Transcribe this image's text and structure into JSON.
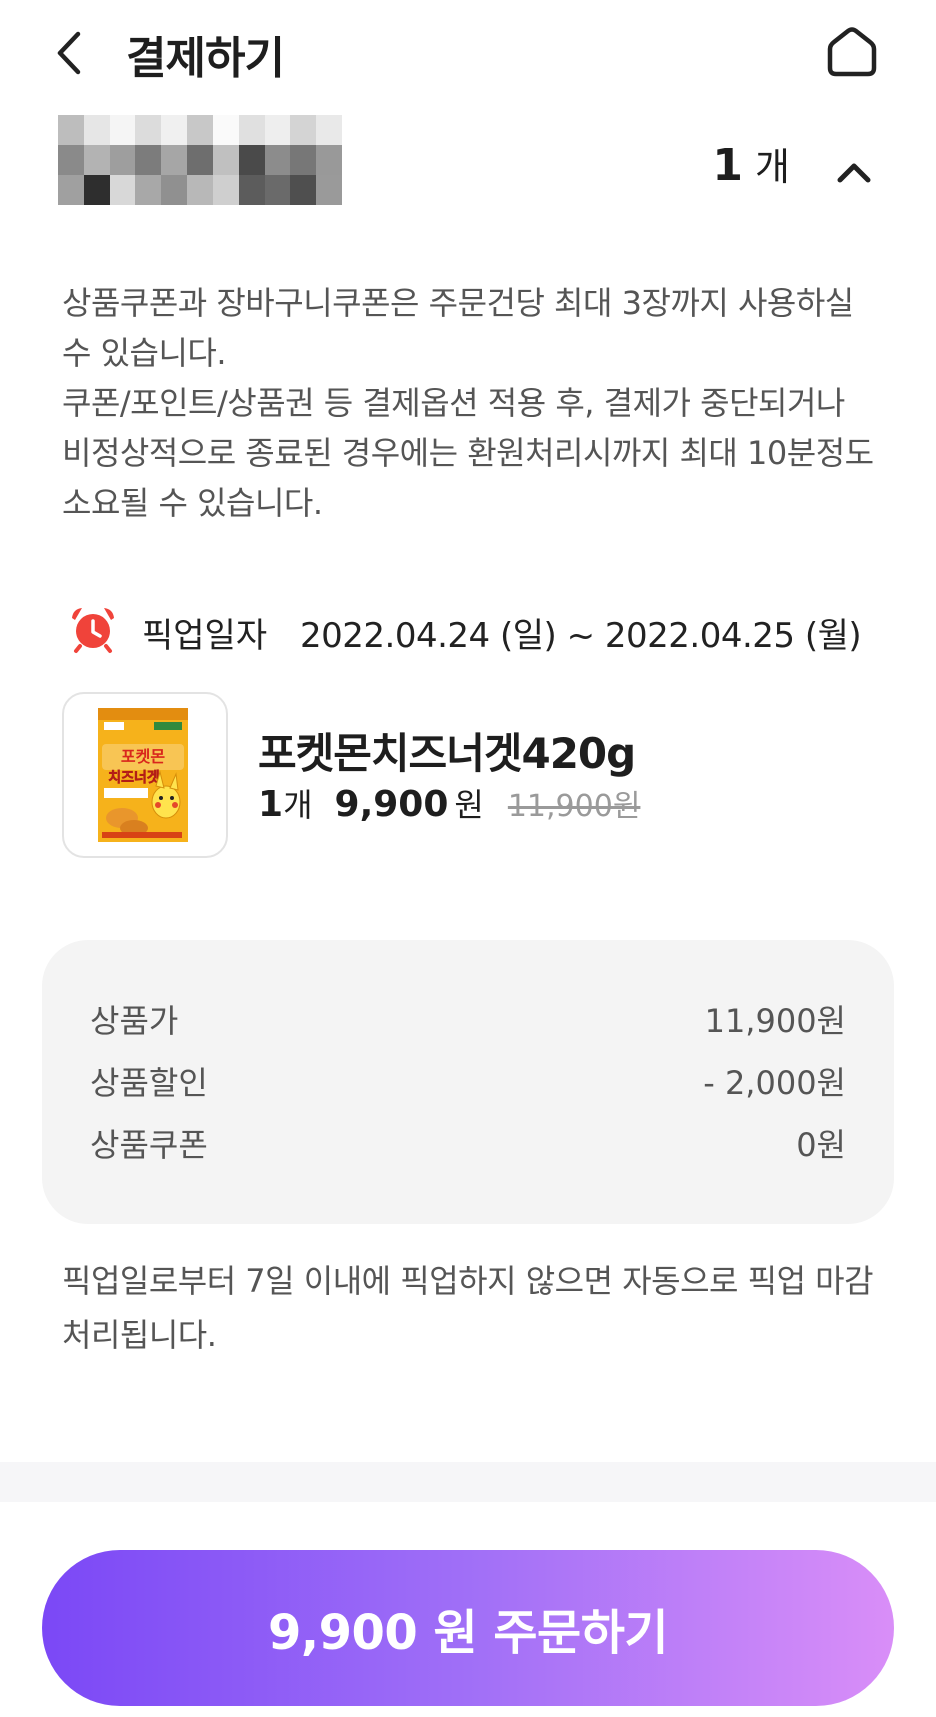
{
  "header": {
    "title": "결제하기",
    "back_icon": "chevron-left-icon",
    "home_icon": "home-icon"
  },
  "store": {
    "quantity": "1",
    "quantity_unit": "개",
    "collapse_icon": "chevron-up-icon"
  },
  "notice": {
    "line1": "상품쿠폰과 장바구니쿠폰은 주문건당 최대 3장까지 사용하실 수 있습니다.",
    "line2": "쿠폰/포인트/상품권 등 결제옵션 적용 후, 결제가 중단되거나 비정상적으로 종료된 경우에는 환원처리시까지 최대 10분정도 소요될 수 있습니다."
  },
  "pickup": {
    "icon": "alarm-clock-icon",
    "label": "픽업일자",
    "dates": "2022.04.24 (일) ~ 2022.04.25 (월)"
  },
  "product": {
    "name": "포켓몬치즈너겟420g",
    "quantity": "1",
    "quantity_unit": "개",
    "price": "9,900",
    "price_unit": "원",
    "original_price": "11,900원",
    "package_text_top": "포켓몬",
    "package_text_bottom": "치즈너겟"
  },
  "summary": {
    "rows": [
      {
        "label": "상품가",
        "value": "11,900원"
      },
      {
        "label": "상품할인",
        "value": "- 2,000원"
      },
      {
        "label": "상품쿠폰",
        "value": "0원"
      }
    ]
  },
  "pickup_notice": "픽업일로부터 7일 이내에 픽업하지 않으면 자동으로 픽업 마감처리됩니다.",
  "order_button": {
    "label": "9,900 원 주문하기"
  },
  "colors": {
    "button_gradient_start": "#7b48f6",
    "button_gradient_end": "#d98ef8",
    "alarm_red": "#f0433a",
    "summary_bg": "#f4f4f4"
  }
}
